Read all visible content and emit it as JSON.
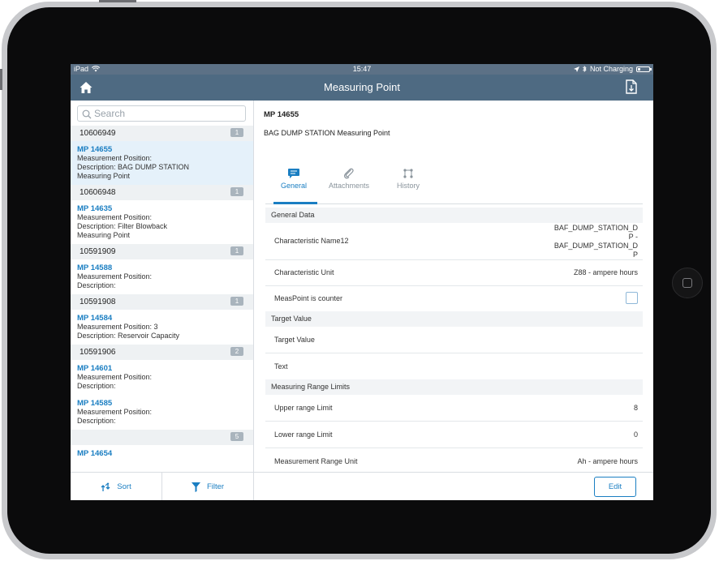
{
  "status_bar": {
    "device": "iPad",
    "time": "15:47",
    "battery_status": "Not Charging",
    "battery_level": 0.2
  },
  "nav": {
    "title": "Measuring Point",
    "left_icon": "home-icon",
    "right_icon": "document-icon"
  },
  "search": {
    "placeholder": "Search"
  },
  "list": {
    "groups": [
      {
        "id": "10606949",
        "count": "1",
        "items": [
          {
            "title": "MP 14655",
            "line1": "Measurement Position:",
            "line2": "Description: BAG DUMP STATION",
            "line3": "Measuring Point",
            "selected": true
          }
        ]
      },
      {
        "id": "10606948",
        "count": "1",
        "items": [
          {
            "title": "MP 14635",
            "line1": "Measurement Position:",
            "line2": "Description: Filter Blowback",
            "line3": "Measuring Point",
            "selected": false
          }
        ]
      },
      {
        "id": "10591909",
        "count": "1",
        "items": [
          {
            "title": "MP 14588",
            "line1": "Measurement Position:",
            "line2": "Description:",
            "line3": "",
            "selected": false
          }
        ]
      },
      {
        "id": "10591908",
        "count": "1",
        "items": [
          {
            "title": "MP 14584",
            "line1": "Measurement Position: 3",
            "line2": "Description: Reservoir Capacity",
            "line3": "",
            "selected": false
          }
        ]
      },
      {
        "id": "10591906",
        "count": "2",
        "items": [
          {
            "title": "MP 14601",
            "line1": "Measurement Position:",
            "line2": "Description:",
            "line3": "",
            "selected": false
          },
          {
            "title": "MP 14585",
            "line1": "Measurement Position:",
            "line2": "Description:",
            "line3": "",
            "selected": false
          }
        ]
      },
      {
        "id": "",
        "count": "5",
        "items": [
          {
            "title": "MP 14654",
            "line1": "",
            "line2": "",
            "line3": "",
            "selected": false
          }
        ]
      }
    ]
  },
  "footer": {
    "sort_label": "Sort",
    "filter_label": "Filter"
  },
  "detail": {
    "title": "MP 14655",
    "subtitle": "BAG DUMP STATION Measuring Point",
    "tabs": [
      {
        "label": "General",
        "icon": "comment-icon",
        "active": true
      },
      {
        "label": "Attachments",
        "icon": "paperclip-icon",
        "active": false
      },
      {
        "label": "History",
        "icon": "history-icon",
        "active": false
      }
    ],
    "general_data_header": "General Data",
    "char_name_label": "Characteristic Name12",
    "char_name_value_lines": [
      "BAF_DUMP_STATION_D",
      "P -",
      "BAF_DUMP_STATION_D",
      "P"
    ],
    "char_unit_label": "Characteristic Unit",
    "char_unit_value": "Z88 - ampere hours",
    "counter_label": "MeasPoint is counter",
    "counter_checked": false,
    "target_header": "Target Value",
    "target_value_label": "Target Value",
    "target_value": "",
    "text_label": "Text",
    "text_value": "",
    "range_header": "Measuring Range Limits",
    "upper_label": "Upper range Limit",
    "upper_value": "8",
    "lower_label": "Lower range Limit",
    "lower_value": "0",
    "range_unit_label": "Measurement Range Unit",
    "range_unit_value": "Ah - ampere hours",
    "edit_label": "Edit"
  },
  "colors": {
    "nav_bg": "#4e6a82",
    "status_bg": "#5c7186",
    "accent": "#1a7ec2",
    "selected_row": "#e5f1fa"
  }
}
